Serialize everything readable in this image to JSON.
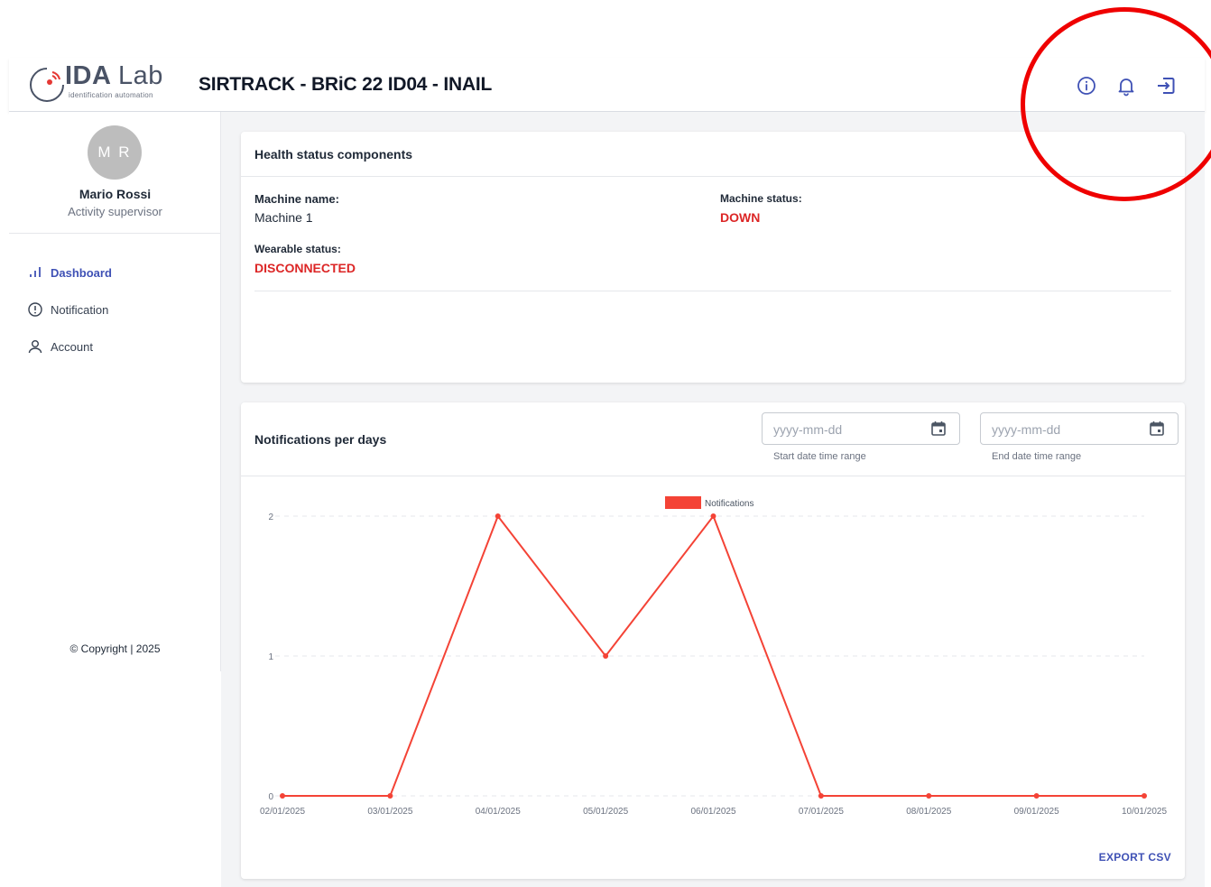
{
  "logo": {
    "word": "IDA",
    "word2": "Lab",
    "tagline": "identification automation"
  },
  "header": {
    "title": "SIRTRACK - BRiC 22 ID04 - INAIL"
  },
  "header_icons": [
    "info-icon",
    "bell-icon",
    "logout-icon"
  ],
  "user": {
    "initials": "M R",
    "name": "Mario Rossi",
    "role": "Activity supervisor"
  },
  "nav": [
    {
      "label": "Dashboard",
      "icon": "bar-chart-icon",
      "active": true
    },
    {
      "label": "Notification",
      "icon": "alert-circle-icon",
      "active": false
    },
    {
      "label": "Account",
      "icon": "user-icon",
      "active": false
    }
  ],
  "copyright": "© Copyright | 2025",
  "health": {
    "title": "Health status components",
    "machine_name_label": "Machine name:",
    "machine_name_value": "Machine 1",
    "machine_status_label": "Machine status:",
    "machine_status_value": "DOWN",
    "wearable_status_label": "Wearable status:",
    "wearable_status_value": "DISCONNECTED"
  },
  "notifications_card": {
    "title": "Notifications per days",
    "start_placeholder": "yyyy-mm-dd",
    "start_helper": "Start date time range",
    "end_placeholder": "yyyy-mm-dd",
    "end_helper": "End date time range",
    "export_label": "EXPORT CSV"
  },
  "colors": {
    "accent": "#3f51b5",
    "status_red": "#dc2626",
    "series": "#f44336",
    "annotation": "#ef0000"
  },
  "chart_data": {
    "type": "line",
    "x": [
      "02/01/2025",
      "03/01/2025",
      "04/01/2025",
      "05/01/2025",
      "06/01/2025",
      "07/01/2025",
      "08/01/2025",
      "09/01/2025",
      "10/01/2025"
    ],
    "series": [
      {
        "name": "Notifications",
        "values": [
          0,
          0,
          2,
          1,
          2,
          0,
          0,
          0,
          0
        ]
      }
    ],
    "yticks": [
      0,
      1,
      2
    ],
    "ylim": [
      0,
      2
    ],
    "grid": "horizontal-dashed",
    "legend": "top-center"
  }
}
